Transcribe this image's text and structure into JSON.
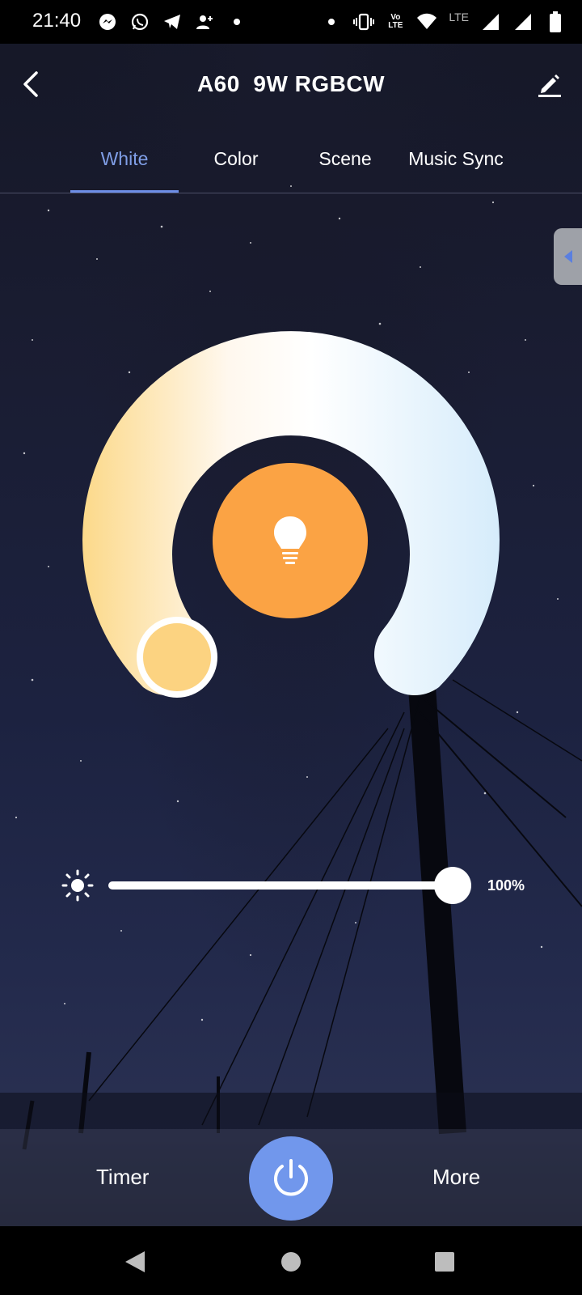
{
  "status_bar": {
    "time": "21:40",
    "left_icons": [
      "messenger-icon",
      "whatsapp-icon",
      "telegram-icon",
      "add-person-icon",
      "dot-icon"
    ],
    "right_icons": [
      "dot-icon",
      "vibrate-icon",
      "volte-icon",
      "wifi-icon",
      "signal-icon",
      "signal-icon",
      "battery-icon"
    ],
    "volte_label": "Vo LTE",
    "lte_label": "LTE"
  },
  "header": {
    "title": "A60  9W RGBCW",
    "back_icon": "back-icon",
    "edit_icon": "edit-icon"
  },
  "tabs": [
    {
      "label": "White",
      "active": true
    },
    {
      "label": "Color",
      "active": false
    },
    {
      "label": "Scene",
      "active": false
    },
    {
      "label": "Music Sync",
      "active": false
    }
  ],
  "dial": {
    "warm_color": "#fcd98a",
    "cool_color": "#d6ecfb",
    "center_color": "#fba344",
    "center_icon": "bulb-icon"
  },
  "brightness": {
    "icon": "sun-icon",
    "value_label": "100%",
    "level": 1.0
  },
  "bottom": {
    "timer_label": "Timer",
    "more_label": "More",
    "power_icon": "power-icon",
    "power_color": "#7197ec"
  },
  "navigation": [
    "back-triangle-icon",
    "home-circle-icon",
    "recents-square-icon"
  ]
}
